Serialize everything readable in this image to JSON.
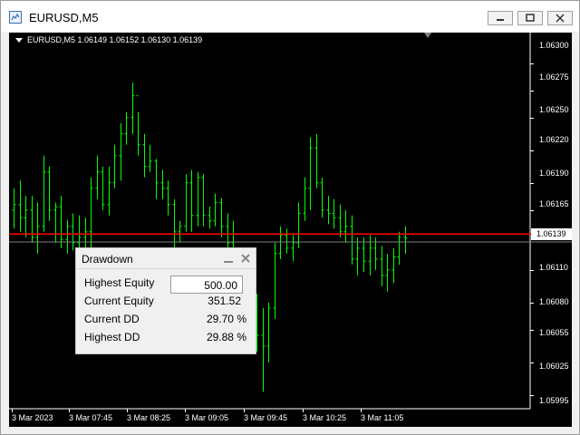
{
  "window": {
    "title": "EURUSD,M5"
  },
  "chart": {
    "header": "EURUSD,M5  1.06149 1.06152 1.06130 1.06139",
    "current_price_label": "1.06139",
    "price_axis": [
      "1.06300",
      "1.06275",
      "1.06250",
      "1.06220",
      "1.06190",
      "1.06165",
      "1.06110",
      "1.06080",
      "1.06055",
      "1.06025",
      "1.05995"
    ],
    "time_axis": [
      "3 Mar 2023",
      "3 Mar 07:45",
      "3 Mar 08:25",
      "3 Mar 09:05",
      "3 Mar 09:45",
      "3 Mar 10:25",
      "3 Mar 11:05"
    ],
    "colors": {
      "background": "#000000",
      "bars": "#00ff00",
      "bid_line": "#ff0000",
      "ask_line": "#808080",
      "axis": "#ffffff"
    }
  },
  "chart_data": {
    "type": "ohlc",
    "symbol": "EURUSD",
    "timeframe": "M5",
    "ylim": [
      1.05985,
      1.06318
    ],
    "bid": 1.06143,
    "ask": 1.06139,
    "y_ticks": [
      1.063,
      1.06275,
      1.0625,
      1.0622,
      1.0619,
      1.06165,
      1.0611,
      1.0608,
      1.06055,
      1.06025,
      1.05995
    ],
    "x_ticks": [
      "3 Mar 2023",
      "3 Mar 07:45",
      "3 Mar 08:25",
      "3 Mar 09:05",
      "3 Mar 09:45",
      "3 Mar 10:25",
      "3 Mar 11:05"
    ],
    "bars": [
      {
        "o": 1.06165,
        "h": 1.06185,
        "l": 1.06148,
        "c": 1.0617
      },
      {
        "o": 1.0617,
        "h": 1.06192,
        "l": 1.06145,
        "c": 1.06158
      },
      {
        "o": 1.06158,
        "h": 1.06178,
        "l": 1.0614,
        "c": 1.06165
      },
      {
        "o": 1.06165,
        "h": 1.06178,
        "l": 1.06135,
        "c": 1.0614
      },
      {
        "o": 1.0614,
        "h": 1.06172,
        "l": 1.06125,
        "c": 1.0615
      },
      {
        "o": 1.0615,
        "h": 1.06215,
        "l": 1.06145,
        "c": 1.062
      },
      {
        "o": 1.062,
        "h": 1.06205,
        "l": 1.06155,
        "c": 1.06165
      },
      {
        "o": 1.06165,
        "h": 1.06172,
        "l": 1.06135,
        "c": 1.06168
      },
      {
        "o": 1.06168,
        "h": 1.06178,
        "l": 1.0613,
        "c": 1.06138
      },
      {
        "o": 1.06138,
        "h": 1.06156,
        "l": 1.06125,
        "c": 1.0615
      },
      {
        "o": 1.0615,
        "h": 1.06162,
        "l": 1.06128,
        "c": 1.06135
      },
      {
        "o": 1.06135,
        "h": 1.0616,
        "l": 1.06125,
        "c": 1.0614
      },
      {
        "o": 1.0614,
        "h": 1.06158,
        "l": 1.06128,
        "c": 1.06145
      },
      {
        "o": 1.06145,
        "h": 1.06195,
        "l": 1.0613,
        "c": 1.06185
      },
      {
        "o": 1.06185,
        "h": 1.06215,
        "l": 1.06175,
        "c": 1.062
      },
      {
        "o": 1.062,
        "h": 1.06205,
        "l": 1.06165,
        "c": 1.0617
      },
      {
        "o": 1.0617,
        "h": 1.06205,
        "l": 1.0616,
        "c": 1.0619
      },
      {
        "o": 1.0619,
        "h": 1.06225,
        "l": 1.06185,
        "c": 1.06215
      },
      {
        "o": 1.06215,
        "h": 1.06245,
        "l": 1.06192,
        "c": 1.06235
      },
      {
        "o": 1.06235,
        "h": 1.06255,
        "l": 1.06225,
        "c": 1.0625
      },
      {
        "o": 1.0625,
        "h": 1.06282,
        "l": 1.06235,
        "c": 1.0627
      },
      {
        "o": 1.0627,
        "h": 1.06255,
        "l": 1.06215,
        "c": 1.06225
      },
      {
        "o": 1.06225,
        "h": 1.06235,
        "l": 1.06195,
        "c": 1.06205
      },
      {
        "o": 1.06205,
        "h": 1.06225,
        "l": 1.062,
        "c": 1.0621
      },
      {
        "o": 1.0621,
        "h": 1.06212,
        "l": 1.06175,
        "c": 1.0619
      },
      {
        "o": 1.0619,
        "h": 1.06202,
        "l": 1.06175,
        "c": 1.06185
      },
      {
        "o": 1.06185,
        "h": 1.06192,
        "l": 1.0616,
        "c": 1.0617
      },
      {
        "o": 1.0617,
        "h": 1.06175,
        "l": 1.0613,
        "c": 1.06145
      },
      {
        "o": 1.06145,
        "h": 1.06155,
        "l": 1.06135,
        "c": 1.0615
      },
      {
        "o": 1.0615,
        "h": 1.06198,
        "l": 1.06145,
        "c": 1.0619
      },
      {
        "o": 1.0619,
        "h": 1.06202,
        "l": 1.06145,
        "c": 1.0616
      },
      {
        "o": 1.0616,
        "h": 1.062,
        "l": 1.0615,
        "c": 1.06195
      },
      {
        "o": 1.06195,
        "h": 1.06198,
        "l": 1.0615,
        "c": 1.0616
      },
      {
        "o": 1.0616,
        "h": 1.06168,
        "l": 1.06148,
        "c": 1.06155
      },
      {
        "o": 1.06155,
        "h": 1.0618,
        "l": 1.0615,
        "c": 1.06172
      },
      {
        "o": 1.06172,
        "h": 1.06176,
        "l": 1.0614,
        "c": 1.0615
      },
      {
        "o": 1.0615,
        "h": 1.06162,
        "l": 1.06125,
        "c": 1.06135
      },
      {
        "o": 1.06135,
        "h": 1.06155,
        "l": 1.0612,
        "c": 1.0612
      },
      {
        "o": 1.0612,
        "h": 1.0613,
        "l": 1.0608,
        "c": 1.06088
      },
      {
        "o": 1.06088,
        "h": 1.06118,
        "l": 1.06075,
        "c": 1.0611
      },
      {
        "o": 1.0611,
        "h": 1.06122,
        "l": 1.06055,
        "c": 1.06065
      },
      {
        "o": 1.06065,
        "h": 1.06088,
        "l": 1.06035,
        "c": 1.0605
      },
      {
        "o": 1.0605,
        "h": 1.06075,
        "l": 1.05998,
        "c": 1.0604
      },
      {
        "o": 1.0604,
        "h": 1.0608,
        "l": 1.06025,
        "c": 1.06075
      },
      {
        "o": 1.06075,
        "h": 1.06135,
        "l": 1.06065,
        "c": 1.06125
      },
      {
        "o": 1.06125,
        "h": 1.0615,
        "l": 1.0612,
        "c": 1.06142
      },
      {
        "o": 1.06142,
        "h": 1.06148,
        "l": 1.06125,
        "c": 1.0613
      },
      {
        "o": 1.0613,
        "h": 1.06142,
        "l": 1.06118,
        "c": 1.06135
      },
      {
        "o": 1.06135,
        "h": 1.06172,
        "l": 1.0613,
        "c": 1.06162
      },
      {
        "o": 1.06162,
        "h": 1.06195,
        "l": 1.06155,
        "c": 1.06185
      },
      {
        "o": 1.06185,
        "h": 1.06232,
        "l": 1.06165,
        "c": 1.06222
      },
      {
        "o": 1.06222,
        "h": 1.06235,
        "l": 1.06185,
        "c": 1.0619
      },
      {
        "o": 1.0619,
        "h": 1.06195,
        "l": 1.06158,
        "c": 1.06165
      },
      {
        "o": 1.06165,
        "h": 1.06178,
        "l": 1.06152,
        "c": 1.06162
      },
      {
        "o": 1.06162,
        "h": 1.06175,
        "l": 1.06148,
        "c": 1.06158
      },
      {
        "o": 1.06158,
        "h": 1.0617,
        "l": 1.0614,
        "c": 1.06145
      },
      {
        "o": 1.06145,
        "h": 1.06165,
        "l": 1.06135,
        "c": 1.0615
      },
      {
        "o": 1.0615,
        "h": 1.0616,
        "l": 1.06115,
        "c": 1.0612
      },
      {
        "o": 1.0612,
        "h": 1.0614,
        "l": 1.06105,
        "c": 1.0613
      },
      {
        "o": 1.0613,
        "h": 1.0614,
        "l": 1.06108,
        "c": 1.06118
      },
      {
        "o": 1.06118,
        "h": 1.06142,
        "l": 1.06105,
        "c": 1.0613
      },
      {
        "o": 1.0613,
        "h": 1.0614,
        "l": 1.0611,
        "c": 1.0612
      },
      {
        "o": 1.0612,
        "h": 1.06132,
        "l": 1.06095,
        "c": 1.06105
      },
      {
        "o": 1.06105,
        "h": 1.06125,
        "l": 1.0609,
        "c": 1.0611
      },
      {
        "o": 1.0611,
        "h": 1.0613,
        "l": 1.06098,
        "c": 1.06122
      },
      {
        "o": 1.06122,
        "h": 1.06145,
        "l": 1.06115,
        "c": 1.0614
      },
      {
        "o": 1.0614,
        "h": 1.0615,
        "l": 1.06125,
        "c": 1.06139
      }
    ]
  },
  "panel": {
    "title": "Drawdown",
    "highest_equity_label": "Highest Equity",
    "highest_equity_value": "500.00",
    "current_equity_label": "Current Equity",
    "current_equity_value": "351.52",
    "current_dd_label": "Current DD",
    "current_dd_value": "29.70 %",
    "highest_dd_label": "Highest DD",
    "highest_dd_value": "29.88 %"
  }
}
